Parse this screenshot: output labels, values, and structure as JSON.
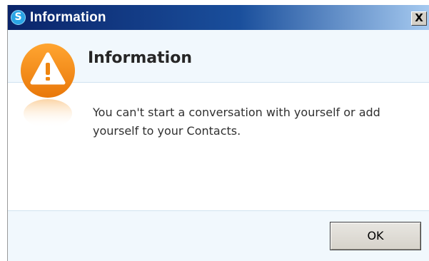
{
  "window": {
    "title": "Information",
    "app_icon_letter": "S",
    "close_glyph": "X"
  },
  "dialog": {
    "heading": "Information",
    "message": "You can't start a conversation with yourself or add yourself to your Contacts.",
    "icon": "warning-icon"
  },
  "buttons": {
    "ok_label": "OK"
  },
  "colors": {
    "warning_orange": "#f08a12",
    "titlebar_dark": "#0a246a",
    "band_background": "#f1f8fd"
  }
}
